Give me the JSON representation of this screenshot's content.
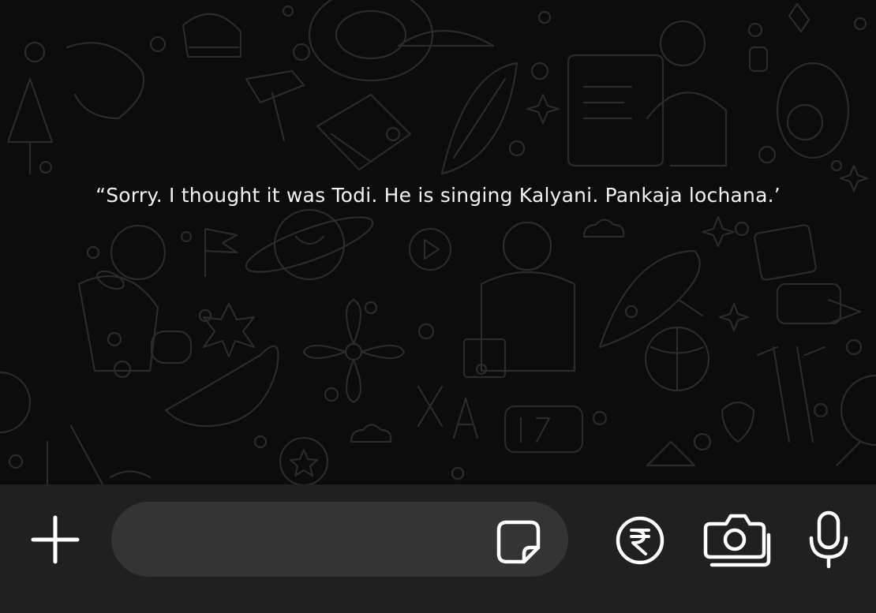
{
  "chat": {
    "message_text": "“Sorry. I thought it was Todi. He is singing Kalyani. Pankaja lochana.’",
    "wallpaper": "doodle-pattern",
    "background_color": "#0c0c0c",
    "doodle_color": "#2b2b2b",
    "text_color": "#f2f2f2"
  },
  "composer": {
    "attach_icon": "plus-icon",
    "input_value": "",
    "input_placeholder": "",
    "sticker_icon": "sticker-icon",
    "payment_icon": "rupee-icon",
    "camera_icon": "camera-icon",
    "mic_icon": "mic-icon",
    "bar_color": "#1f2021",
    "input_color": "#333436",
    "icon_color": "#ffffff"
  }
}
